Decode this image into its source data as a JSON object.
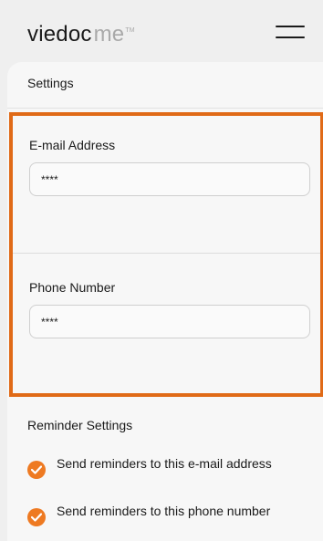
{
  "header": {
    "logo_brand": "viedoc",
    "logo_me": "me",
    "logo_tm": "TM"
  },
  "page": {
    "title": "Settings"
  },
  "email": {
    "label": "E-mail Address",
    "value": "****"
  },
  "phone": {
    "label": "Phone Number",
    "value": "****"
  },
  "reminders": {
    "title": "Reminder Settings",
    "options": [
      {
        "label": "Send reminders to this e-mail address",
        "checked": true
      },
      {
        "label": "Send reminders to this phone number",
        "checked": true
      }
    ]
  },
  "colors": {
    "accent_orange": "#ee7a22",
    "highlight_border": "#e06a17",
    "background": "#efefef",
    "card": "#f7f7f7"
  }
}
